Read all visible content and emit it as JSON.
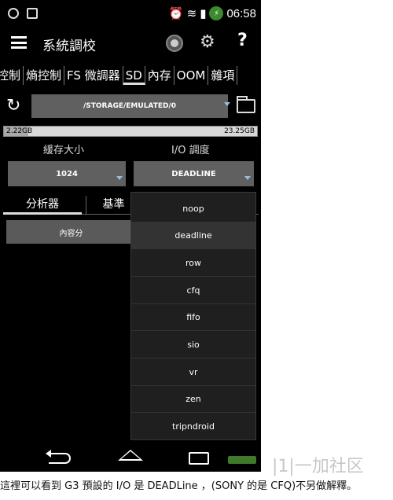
{
  "status_bar": {
    "time": "06:58"
  },
  "app": {
    "title": "系統調校"
  },
  "tabs": [
    {
      "label": "控制"
    },
    {
      "label": "熵控制"
    },
    {
      "label": "FS 微調器"
    },
    {
      "label": "SD"
    },
    {
      "label": "內存"
    },
    {
      "label": "OOM"
    },
    {
      "label": "雜項"
    }
  ],
  "active_tab": "SD",
  "path": "/STORAGE/EMULATED/0",
  "storage": {
    "used": "2.22GB",
    "total": "23.25GB",
    "used_fraction": 0.095
  },
  "cache": {
    "label": "緩存大小",
    "value": "1024"
  },
  "io": {
    "label": "I/O 調度",
    "value": "DEADLINE"
  },
  "subtabs": {
    "analyzer": "分析器",
    "benchmark": "基準"
  },
  "content_button": "內容分",
  "dropdown": {
    "options": [
      "noop",
      "deadline",
      "row",
      "cfq",
      "fifo",
      "sio",
      "vr",
      "zen",
      "tripndroid"
    ],
    "selected": "deadline"
  },
  "watermark": "|1|一加社区",
  "caption": "這裡可以看到 G3 預設的 I/O 是 DEADLine ，(SONY 的是 CFQ)不另做解釋。",
  "colors": {
    "background": "#000000",
    "panel": "#606060",
    "accent": "#99bbdd"
  }
}
